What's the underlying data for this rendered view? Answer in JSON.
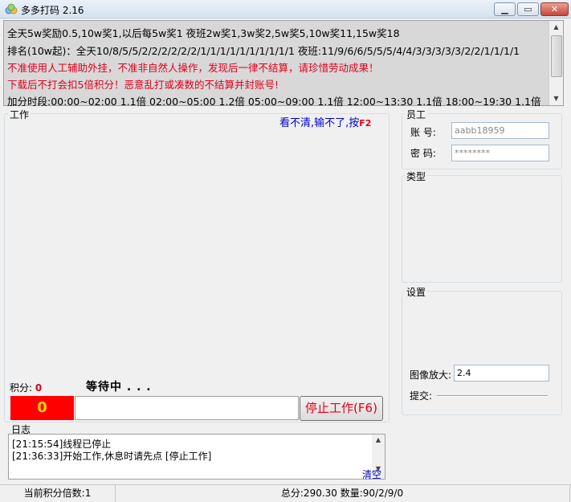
{
  "window": {
    "title": "多多打码 2.16"
  },
  "notice": {
    "lines": [
      "全天5w奖励0.5,10w奖1,以后每5w奖1 夜班2w奖1,3w奖2,5w奖5,10w奖11,15w奖18",
      "排名(10w起)：全天10/8/5/5/2/2/2/2/2/2/1/1/1/1/1/1/1/1/1/1 夜班:11/9/6/6/5/5/5/4/4/3/3/3/3/3/2/2/1/1/1/1",
      "不准使用人工辅助外挂，不准非自然人操作，发现后一律不结算，请珍惜劳动成果！",
      "下载后不打会扣5倍积分！恶意乱打或凑数的不结算并封账号!",
      "加分时段:00:00~02:00 1.1倍 02:00~05:00 1.2倍 05:00~09:00 1.1倍 12:00~13:30 1.1倍 18:00~19:30 1.1倍"
    ]
  },
  "work": {
    "label": "工作",
    "hint": "看不清,输不了,按",
    "hint_key": "F2",
    "score_label": "积分:",
    "score_value": "0",
    "status": "等待中 . . .",
    "score_display": "0",
    "stop_button": "停止工作(F6)"
  },
  "log": {
    "label": "日志",
    "entries": [
      "[21:15:54]线程已停止",
      "[21:36:33]开始工作,休息时请先点 [停止工作]"
    ],
    "clear": "清空"
  },
  "employee": {
    "label": "员工",
    "account_label": "账  号:",
    "account_value": "aabb18959",
    "password_label": "密  码:",
    "password_value": "********"
  },
  "type": {
    "label": "类型"
  },
  "settings": {
    "label": "设置",
    "zoom_label": "图像放大:",
    "zoom_value": "2.4",
    "submit_label": "提交:"
  },
  "statusbar": {
    "multiplier": "当前积分倍数:1",
    "totals": "总分:290.30 数量:90/2/9/0"
  }
}
